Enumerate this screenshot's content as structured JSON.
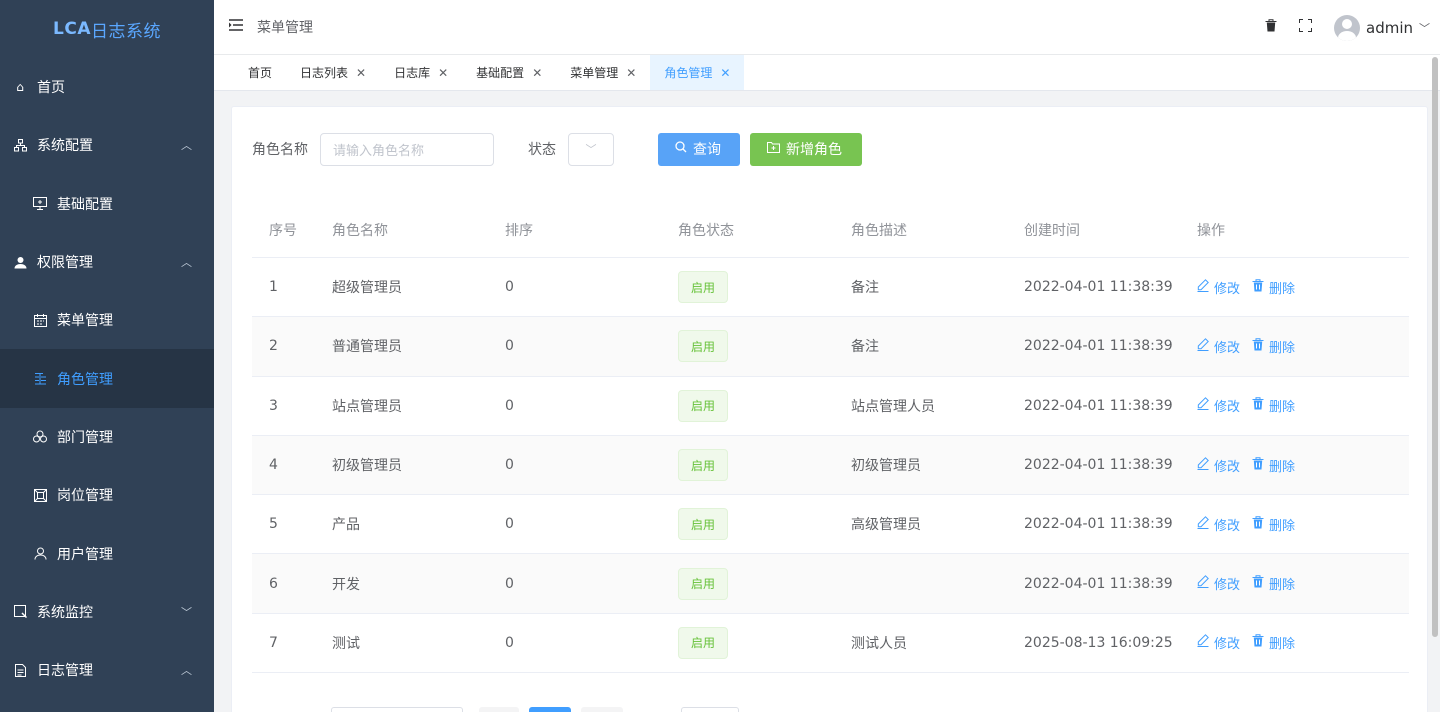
{
  "logo": {
    "brand": "LCA",
    "text": "日志系统"
  },
  "sidebar": {
    "items": [
      {
        "label": "首页",
        "icon": "home-icon",
        "arrow": ""
      },
      {
        "label": "系统配置",
        "icon": "sitemap-icon",
        "arrow": "^"
      },
      {
        "label": "基础配置",
        "icon": "monitor-icon",
        "arrow": ""
      },
      {
        "label": "权限管理",
        "icon": "user-icon",
        "arrow": "^"
      },
      {
        "label": "菜单管理",
        "icon": "calendar-icon",
        "arrow": ""
      },
      {
        "label": "角色管理",
        "icon": "role-icon",
        "arrow": ""
      },
      {
        "label": "部门管理",
        "icon": "department-icon",
        "arrow": ""
      },
      {
        "label": "岗位管理",
        "icon": "position-icon",
        "arrow": ""
      },
      {
        "label": "用户管理",
        "icon": "person-icon",
        "arrow": ""
      },
      {
        "label": "系统监控",
        "icon": "monitor-icon",
        "arrow": "v"
      },
      {
        "label": "日志管理",
        "icon": "log-icon",
        "arrow": "^"
      }
    ]
  },
  "header": {
    "crumb": "菜单管理",
    "user": "admin"
  },
  "tabs": [
    {
      "label": "首页",
      "closable": false
    },
    {
      "label": "日志列表",
      "closable": true
    },
    {
      "label": "日志库",
      "closable": true
    },
    {
      "label": "基础配置",
      "closable": true
    },
    {
      "label": "菜单管理",
      "closable": true
    },
    {
      "label": "角色管理",
      "closable": true
    }
  ],
  "form": {
    "role_name_label": "角色名称",
    "role_name_placeholder": "请输入角色名称",
    "status_label": "状态",
    "query_label": "查询",
    "add_label": "新增角色"
  },
  "table": {
    "columns": [
      "序号",
      "角色名称",
      "排序",
      "角色状态",
      "角色描述",
      "创建时间",
      "操作"
    ],
    "rows": [
      {
        "no": "1",
        "name": "超级管理员",
        "sort": "0",
        "status": "启用",
        "desc": "备注",
        "created": "2022-04-01 11:38:39"
      },
      {
        "no": "2",
        "name": "普通管理员",
        "sort": "0",
        "status": "启用",
        "desc": "备注",
        "created": "2022-04-01 11:38:39"
      },
      {
        "no": "3",
        "name": "站点管理员",
        "sort": "0",
        "status": "启用",
        "desc": "站点管理人员",
        "created": "2022-04-01 11:38:39"
      },
      {
        "no": "4",
        "name": "初级管理员",
        "sort": "0",
        "status": "启用",
        "desc": "初级管理员",
        "created": "2022-04-01 11:38:39"
      },
      {
        "no": "5",
        "name": "产品",
        "sort": "0",
        "status": "启用",
        "desc": "高级管理员",
        "created": "2022-04-01 11:38:39"
      },
      {
        "no": "6",
        "name": "开发",
        "sort": "0",
        "status": "启用",
        "desc": "",
        "created": "2022-04-01 11:38:39"
      },
      {
        "no": "7",
        "name": "测试",
        "sort": "0",
        "status": "启用",
        "desc": "测试人员",
        "created": "2025-08-13 16:09:25"
      }
    ],
    "edit_label": "修改",
    "delete_label": "删除"
  },
  "colors": {
    "sidebar_bg": "#304156",
    "active_text": "#409eff",
    "primary": "#58a3f7",
    "success": "#78c451",
    "tag_text": "#67c23a"
  }
}
